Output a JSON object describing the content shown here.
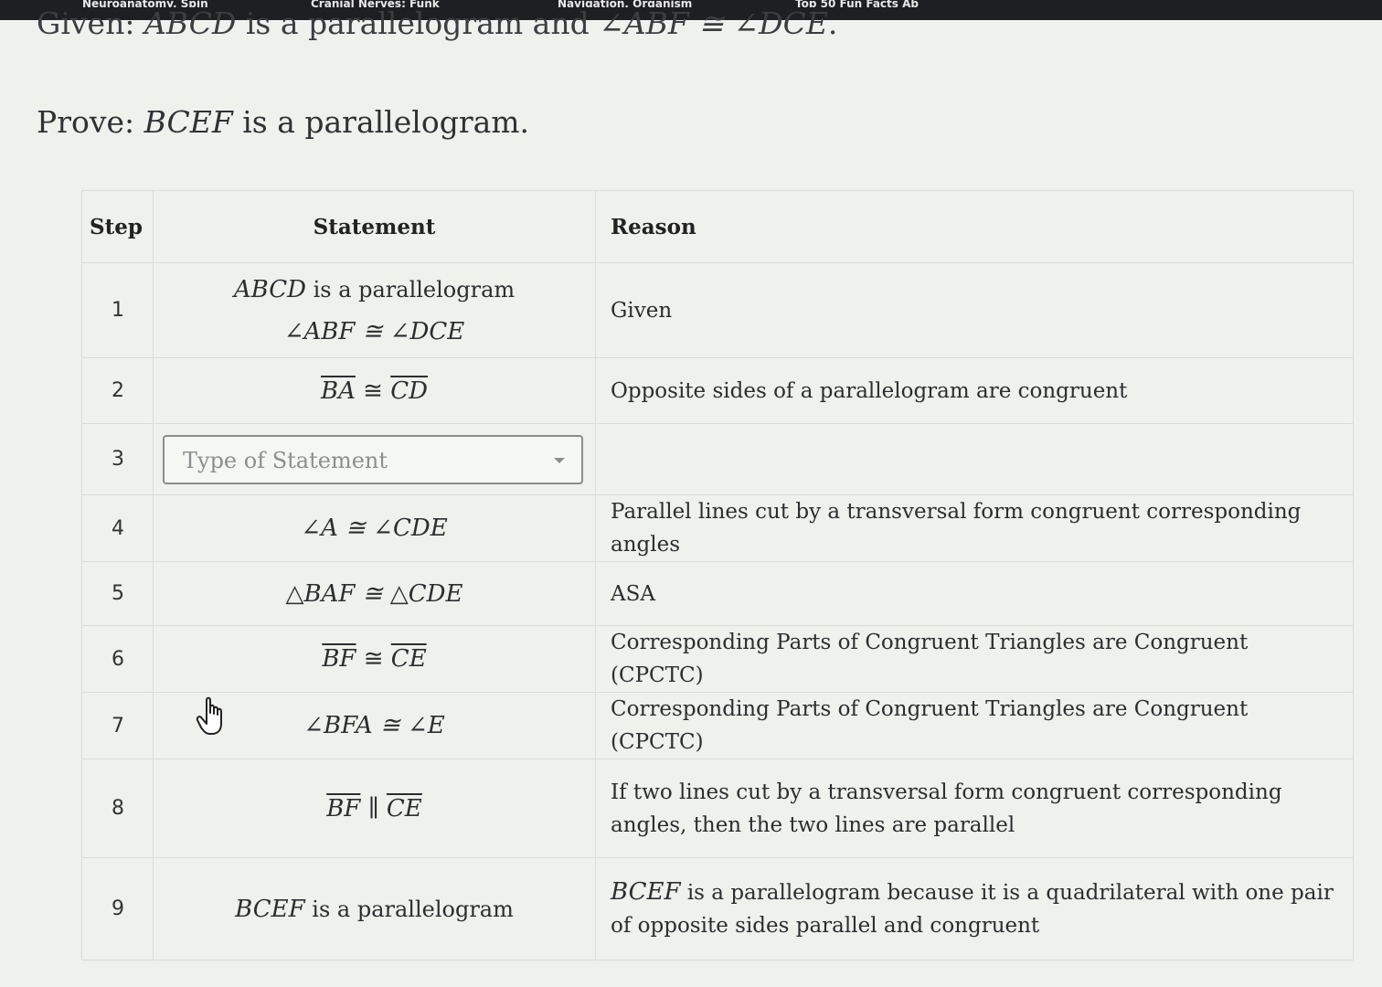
{
  "browser": {
    "tabs": [
      "Neuroanatomy, Spin",
      "Cranial Nerves: Funk",
      "Navigation, Organism",
      "Top 50 Fun Facts Ab"
    ]
  },
  "problem": {
    "given_prefix": "Given: ",
    "given_math1": "ABCD",
    "given_mid": " is a parallelogram and ",
    "given_math2": "∠ABF ≅ ∠DCE",
    "given_end": ".",
    "prove_prefix": "Prove: ",
    "prove_math": "BCEF",
    "prove_suffix": " is a parallelogram."
  },
  "table": {
    "headers": {
      "step": "Step",
      "statement": "Statement",
      "reason": "Reason"
    },
    "rows": [
      {
        "step": "1",
        "s1a": "ABCD",
        "s1b": " is a parallelogram",
        "s1c": "∠ABF ≅ ∠DCE",
        "reason": "Given"
      },
      {
        "step": "2",
        "left": "BA",
        "op": " ≅ ",
        "right": "CD",
        "reason": "Opposite sides of a parallelogram are congruent"
      },
      {
        "step": "3",
        "placeholder": "Type of Statement",
        "reason": ""
      },
      {
        "step": "4",
        "statement": "∠A ≅ ∠CDE",
        "reason": "Parallel lines cut by a transversal form congruent corresponding angles"
      },
      {
        "step": "5",
        "statement": "△BAF ≅ △CDE",
        "reason": "ASA"
      },
      {
        "step": "6",
        "left": "BF",
        "op": " ≅ ",
        "right": "CE",
        "reason": "Corresponding Parts of Congruent Triangles are Congruent (CPCTC)"
      },
      {
        "step": "7",
        "statement": "∠BFA ≅ ∠E",
        "reason": "Corresponding Parts of Congruent Triangles are Congruent (CPCTC)"
      },
      {
        "step": "8",
        "left": "BF",
        "op": " ∥ ",
        "right": "CE",
        "reason": "If two lines cut by a transversal form congruent corresponding angles, then the two lines are parallel"
      },
      {
        "step": "9",
        "s9a": "BCEF",
        "s9b": " is a parallelogram",
        "reason_math": "BCEF",
        "reason_rest": " is a parallelogram because it is a quadrilateral with one pair of opposite sides parallel and congruent"
      }
    ]
  }
}
